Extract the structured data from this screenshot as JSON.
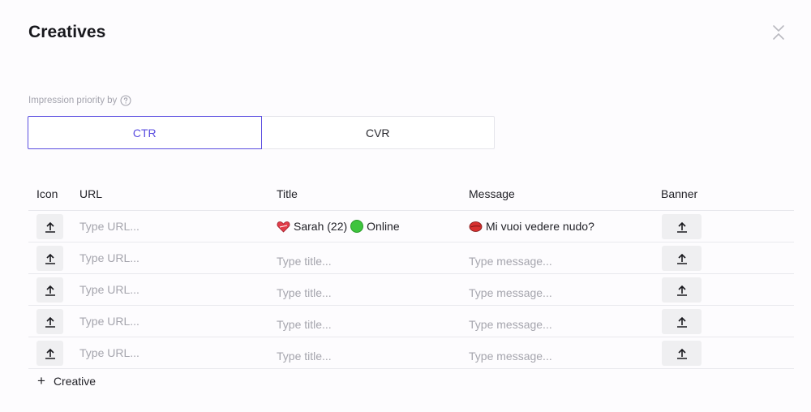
{
  "modal": {
    "title": "Creatives",
    "close_icon": "close-icon"
  },
  "priority": {
    "label": "Impression priority by",
    "help_icon": "question-circle-icon",
    "options": [
      "CTR",
      "CVR"
    ],
    "selected": "CTR",
    "accent_color": "#5b4ee0"
  },
  "table": {
    "headers": {
      "icon": "Icon",
      "url": "URL",
      "title": "Title",
      "message": "Message",
      "banner": "Banner"
    },
    "upload_icon": "upload-icon",
    "rows": [
      {
        "url_placeholder": "Type URL...",
        "title": {
          "emoji": "heart-icon",
          "name": "Sarah (22)",
          "status_icon": "green-circle-icon",
          "status": "Online"
        },
        "message": {
          "emoji": "lips-icon",
          "text": "Mi vuoi vedere nudo?"
        }
      },
      {
        "url_placeholder": "Type URL...",
        "title_placeholder": "Type title...",
        "message_placeholder": "Type message..."
      },
      {
        "url_placeholder": "Type URL...",
        "title_placeholder": "Type title...",
        "message_placeholder": "Type message..."
      },
      {
        "url_placeholder": "Type URL...",
        "title_placeholder": "Type title...",
        "message_placeholder": "Type message..."
      },
      {
        "url_placeholder": "Type URL...",
        "title_placeholder": "Type title...",
        "message_placeholder": "Type message..."
      }
    ]
  },
  "add_creative": {
    "icon": "plus-icon",
    "label": "Creative"
  }
}
